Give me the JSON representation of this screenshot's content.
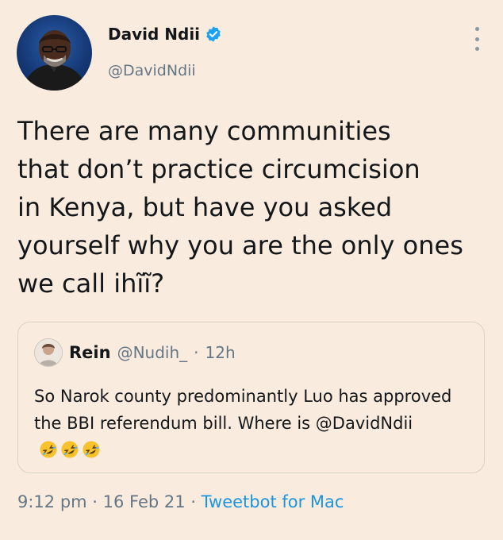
{
  "author": {
    "display_name": "David Ndii",
    "handle": "@DavidNdii",
    "verified": true,
    "avatar_icon": "author-avatar-photo"
  },
  "tweet": {
    "text": "There are many communities\nthat don’t practice circumcision\nin Kenya, but have  you asked\nyourself why you are the only ones\nwe call ihĩĩ?"
  },
  "quoted_tweet": {
    "display_name": "Rein",
    "handle": "@Nudih_",
    "separator": "·",
    "time": "12h",
    "text": "So Narok county predominantly Luo has approved the BBI referendum bill. Where is @DavidNdii",
    "emojis": [
      "rolling-on-floor-laughing-icon",
      "rolling-on-floor-laughing-icon",
      "rolling-on-floor-laughing-icon"
    ]
  },
  "meta": {
    "time": "9:12 pm",
    "separator": " · ",
    "date": "16 Feb 21",
    "source": "Tweetbot for Mac"
  },
  "colors": {
    "background": "#f9ebdd",
    "text": "#14171a",
    "secondary": "#657786",
    "link": "#1b95e0",
    "verified": "#1da1f2",
    "emoji": "#f7c22b"
  }
}
